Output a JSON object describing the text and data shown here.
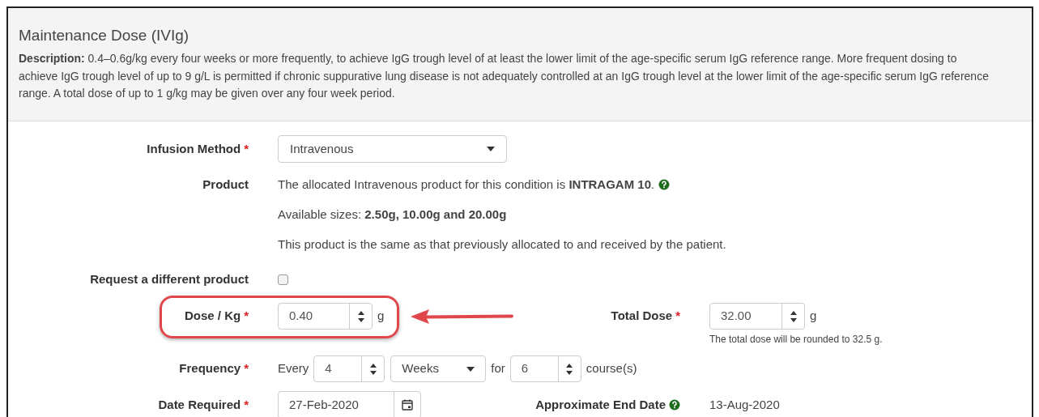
{
  "panel": {
    "title": "Maintenance Dose (IVIg)",
    "description": "**Description:** 0.4–0.6g/kg every four weeks or more frequently, to achieve IgG trough level of at least the lower limit of the age-specific serum IgG reference range. More frequent dosing to achieve IgG trough level of up to 9 g/L is permitted if chronic suppurative lung disease is not adequately controlled at an IgG trough level at the lower limit of the age-specific serum IgG reference range. A total dose of up to 1 g/kg may be given over any four week period."
  },
  "form": {
    "infusion_method": {
      "label": "Infusion Method",
      "required_mark": "*",
      "value": "Intravenous"
    },
    "product": {
      "label": "Product",
      "lines": [
        {
          "text": "The allocated Intravenous product for this condition is **INTRAGAM 10**.",
          "help": true
        },
        {
          "text": "Available sizes: **2.50g, 10.00g and 20.00g**",
          "help": false
        },
        {
          "text": "This product is the same as that previously allocated to and received by the patient.",
          "help": false
        }
      ]
    },
    "request_different": {
      "label": "Request a different product",
      "checked": false
    },
    "dose_per_kg": {
      "label": "Dose / Kg",
      "required_mark": "*",
      "value": "0.40",
      "unit": "g",
      "highlighted": true
    },
    "total_dose": {
      "label": "Total Dose",
      "required_mark": "*",
      "value": "32.00",
      "unit": "g",
      "hint": "The total dose will be rounded to 32.5 g."
    },
    "frequency": {
      "label": "Frequency",
      "required_mark": "*",
      "every": "Every",
      "count": "4",
      "period": "Weeks",
      "for": "for",
      "courses": "6",
      "courses_unit": "course(s)"
    },
    "date_required": {
      "label": "Date Required",
      "required_mark": "*",
      "value": "27-Feb-2020"
    },
    "end_date": {
      "label": "Approximate End Date",
      "help": true,
      "value": "13-Aug-2020"
    }
  }
}
